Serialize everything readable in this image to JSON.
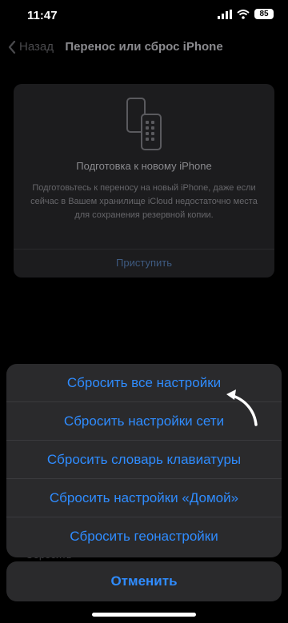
{
  "status": {
    "time": "11:47",
    "battery": "85"
  },
  "nav": {
    "back_label": "Назад",
    "title": "Перенос или сброс iPhone"
  },
  "card": {
    "title": "Подготовка к новому iPhone",
    "text": "Подготовьтесь к переносу на новый iPhone, даже если сейчас в Вашем хранилище iCloud недостаточно места для сохранения резервной копии.",
    "action": "Приступить",
    "icon": "phones-icon"
  },
  "sheet": {
    "items": [
      {
        "label": "Сбросить все настройки"
      },
      {
        "label": "Сбросить настройки сети"
      },
      {
        "label": "Сбросить словарь клавиатуры"
      },
      {
        "label": "Сбросить настройки «Домой»"
      },
      {
        "label": "Сбросить геонастройки"
      }
    ],
    "cancel_label": "Отменить"
  },
  "peek_text": "Сбросить",
  "colors": {
    "accent": "#2f8cff",
    "background": "#000000",
    "sheet": "#2a2a2c",
    "annotation_arrow": "#ffffff"
  }
}
